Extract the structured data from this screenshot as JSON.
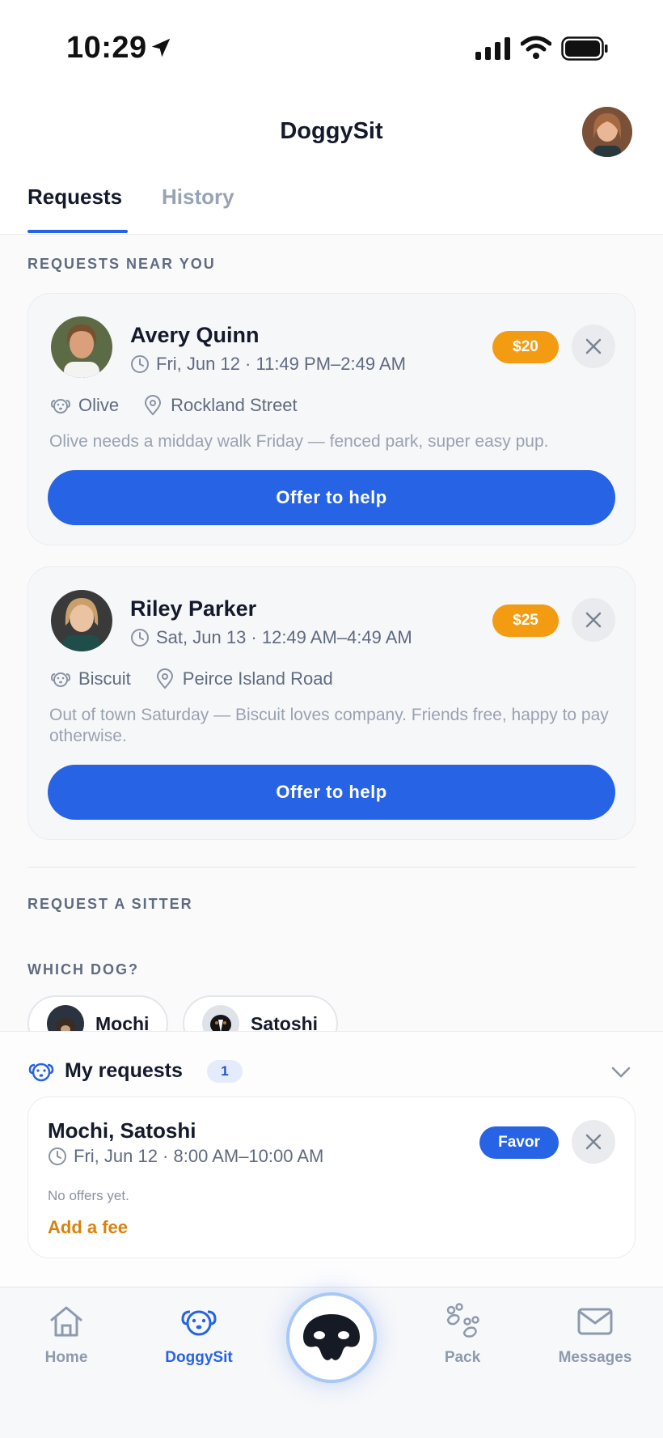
{
  "status_bar": {
    "time": "10:29"
  },
  "header": {
    "title": "DoggySit"
  },
  "tabs": [
    {
      "label": "Requests"
    },
    {
      "label": "History"
    }
  ],
  "sections": {
    "nearby": "REQUESTS NEAR YOU",
    "request_sitter": "REQUEST A SITTER",
    "which_dog": "WHICH DOG?"
  },
  "requests": [
    {
      "name": "Avery Quinn",
      "time": "Fri, Jun 12 · 11:49 PM–2:49 AM",
      "price": "$20",
      "dog": "Olive",
      "location": "Rockland Street",
      "description": "Olive needs a midday walk Friday — fenced park, super easy pup.",
      "action": "Offer to help"
    },
    {
      "name": "Riley Parker",
      "time": "Sat, Jun 13 · 12:49 AM–4:49 AM",
      "price": "$25",
      "dog": "Biscuit",
      "location": "Peirce Island Road",
      "description": "Out of town Saturday — Biscuit loves company. Friends free, happy to pay otherwise.",
      "action": "Offer to help"
    }
  ],
  "dogs": [
    {
      "name": "Mochi"
    },
    {
      "name": "Satoshi"
    }
  ],
  "my_requests": {
    "title": "My requests",
    "count": "1",
    "item": {
      "dogs": "Mochi, Satoshi",
      "time": "Fri, Jun 12 · 8:00 AM–10:00 AM",
      "badge": "Favor",
      "status": "No offers yet.",
      "fee_link": "Add a fee"
    }
  },
  "nav": [
    {
      "label": "Home",
      "icon": "home-icon"
    },
    {
      "label": "DoggySit",
      "icon": "dog-face-icon"
    },
    {
      "label": "",
      "icon": "dog-nose-icon"
    },
    {
      "label": "Pack",
      "icon": "paw-prints-icon"
    },
    {
      "label": "Messages",
      "icon": "mail-icon"
    }
  ],
  "colors": {
    "accent": "#2763e5",
    "price": "#f39c12",
    "fee_link": "#d9820a"
  }
}
